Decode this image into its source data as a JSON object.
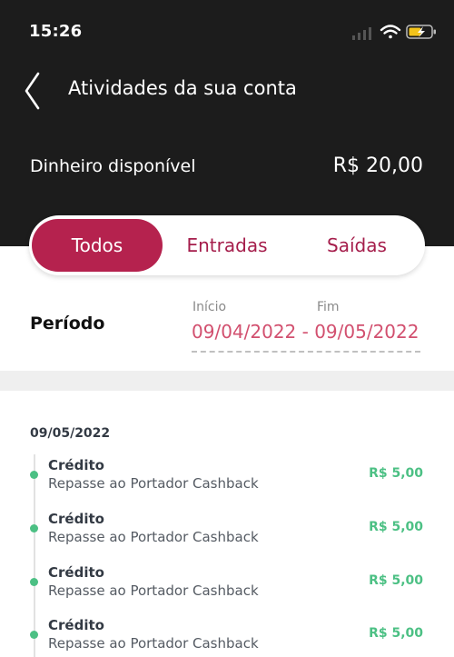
{
  "status_bar": {
    "time": "15:26"
  },
  "header": {
    "title": "Atividades da sua conta"
  },
  "balance": {
    "label": "Dinheiro disponível",
    "value": "R$ 20,00"
  },
  "tabs": [
    {
      "label": "Todos",
      "active": true
    },
    {
      "label": "Entradas",
      "active": false
    },
    {
      "label": "Saídas",
      "active": false
    }
  ],
  "period": {
    "label": "Período",
    "start_label": "Início",
    "end_label": "Fim",
    "range": "09/04/2022 - 09/05/2022"
  },
  "transactions_group": {
    "date": "09/05/2022",
    "items": [
      {
        "type": "Crédito",
        "description": "Repasse ao Portador Cashback",
        "amount": "R$ 5,00"
      },
      {
        "type": "Crédito",
        "description": "Repasse ao Portador Cashback",
        "amount": "R$ 5,00"
      },
      {
        "type": "Crédito",
        "description": "Repasse ao Portador Cashback",
        "amount": "R$ 5,00"
      },
      {
        "type": "Crédito",
        "description": "Repasse ao Portador Cashback",
        "amount": "R$ 5,00"
      }
    ]
  },
  "colors": {
    "header_bg": "#1c1c1c",
    "accent": "#b5224e",
    "date_text": "#d2506f",
    "credit_green": "#4cc084"
  }
}
